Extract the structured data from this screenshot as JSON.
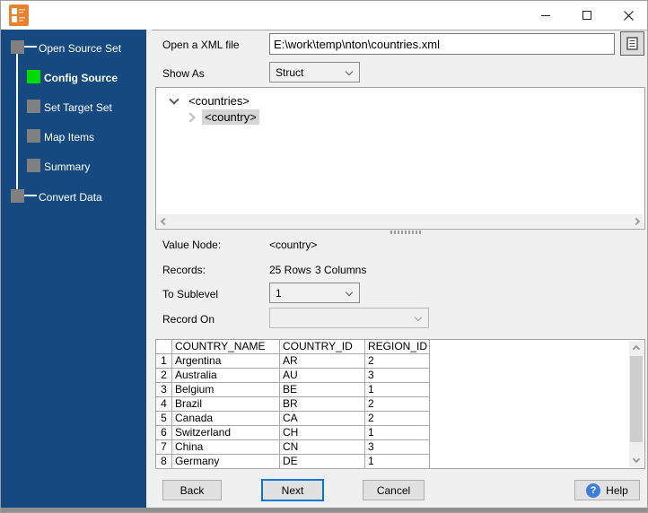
{
  "titlebar": {
    "title": ""
  },
  "sidebar": {
    "steps": [
      {
        "label": "Open Source Set",
        "state": "done"
      },
      {
        "label": "Config Source",
        "state": "active"
      },
      {
        "label": "Set Target Set",
        "state": "pending"
      },
      {
        "label": "Map Items",
        "state": "pending"
      },
      {
        "label": "Summary",
        "state": "pending"
      },
      {
        "label": "Convert Data",
        "state": "pending"
      }
    ]
  },
  "form": {
    "file_label": "Open a XML file",
    "file_value": "E:\\work\\temp\\nton\\countries.xml",
    "show_as_label": "Show As",
    "show_as_value": "Struct",
    "value_node_label": "Value Node:",
    "value_node_value": "<country>",
    "records_label": "Records:",
    "records_rows": "25 Rows",
    "records_columns": "3 Columns",
    "to_sublevel_label": "To Sublevel",
    "to_sublevel_value": "1",
    "record_on_label": "Record On",
    "record_on_value": ""
  },
  "tree": {
    "nodes": [
      {
        "label": "<countries>",
        "expanded": true,
        "selected": false
      },
      {
        "label": "<country>",
        "expanded": false,
        "selected": true
      }
    ]
  },
  "table": {
    "headers": [
      "COUNTRY_NAME",
      "COUNTRY_ID",
      "REGION_ID"
    ],
    "rows": [
      {
        "n": "1",
        "name": "Argentina",
        "id": "AR",
        "region": "2"
      },
      {
        "n": "2",
        "name": "Australia",
        "id": "AU",
        "region": "3"
      },
      {
        "n": "3",
        "name": "Belgium",
        "id": "BE",
        "region": "1"
      },
      {
        "n": "4",
        "name": "Brazil",
        "id": "BR",
        "region": "2"
      },
      {
        "n": "5",
        "name": "Canada",
        "id": "CA",
        "region": "2"
      },
      {
        "n": "6",
        "name": "Switzerland",
        "id": "CH",
        "region": "1"
      },
      {
        "n": "7",
        "name": "China",
        "id": "CN",
        "region": "3"
      },
      {
        "n": "8",
        "name": "Germany",
        "id": "DE",
        "region": "1"
      }
    ]
  },
  "footer": {
    "back": "Back",
    "next": "Next",
    "cancel": "Cancel",
    "help": "Help",
    "help_glyph": "?"
  },
  "icons": {
    "app-icon": "orange-file-convert",
    "browse-icon": "document",
    "minimize-icon": "minimize-dash",
    "maximize-icon": "maximize-square",
    "close-icon": "close-x",
    "help-icon": "blue-question-circle",
    "combo-icon": "chevron-down",
    "tree-expanded-icon": "chevron-down",
    "tree-collapsed-icon": "chevron-right"
  },
  "colors": {
    "sidebar_bg": "#15497F",
    "step_active": "#00DC00",
    "step_pending": "#808080",
    "next_focus_border": "#0078D7",
    "help_icon_bg": "#3D7EDB",
    "main_bg": "#F0F0F0",
    "selection_bg": "#D6D6D6"
  }
}
